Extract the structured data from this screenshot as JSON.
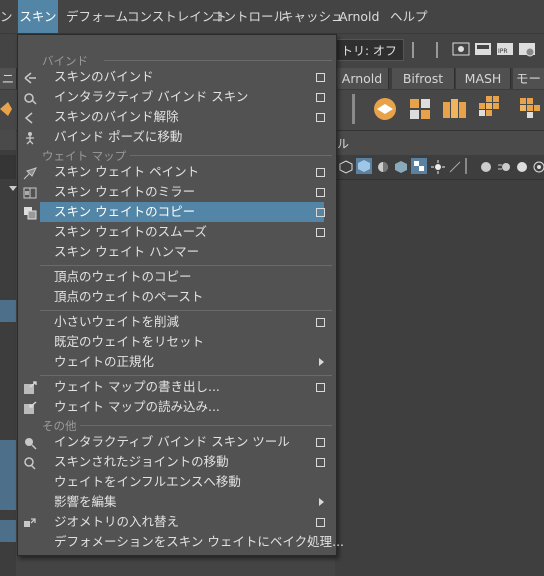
{
  "menubar": {
    "items": [
      {
        "label": "ン"
      },
      {
        "label": "スキン"
      },
      {
        "label": "デフォーム"
      },
      {
        "label": "コンストレイント"
      },
      {
        "label": "コントロール"
      },
      {
        "label": "キャッシュ"
      },
      {
        "label": "Arnold"
      },
      {
        "label": "ヘルプ"
      }
    ]
  },
  "statusline": {
    "field_label": "トリ: オフ"
  },
  "shelf_tabs": [
    "ニメ",
    "Arnold",
    "Bifrost",
    "MASH",
    "モー"
  ],
  "viewport_menu_label": "ル",
  "menu": {
    "sections": {
      "bind": "バインド",
      "weight_map": "ウェイト マップ",
      "other": "その他"
    },
    "items": {
      "bind_skin": "スキンのバインド",
      "interactive_bind_skin": "インタラクティブ バインド スキン",
      "unbind_skin": "スキンのバインド解除",
      "go_to_bind_pose": "バインド ポーズに移動",
      "paint_skin_weights": "スキン ウェイト ペイント",
      "mirror_skin_weights": "スキン ウェイトのミラー",
      "copy_skin_weights": "スキン ウェイトのコピー",
      "smooth_skin_weights": "スキン ウェイトのスムーズ",
      "skin_weight_hammer": "スキン ウェイト ハンマー",
      "copy_vertex_weights": "頂点のウェイトのコピー",
      "paste_vertex_weights": "頂点のウェイトのペースト",
      "prune_small_weights": "小さいウェイトを削減",
      "reset_weights_default": "既定のウェイトをリセット",
      "normalize_weights": "ウェイトの正規化",
      "export_weight_maps": "ウェイト マップの書き出し...",
      "import_weight_maps": "ウェイト マップの読み込み...",
      "interactive_bind_skin_tool": "インタラクティブ バインド スキン ツール",
      "move_skinned_joints": "スキンされたジョイントの移動",
      "move_weights_to_influences": "ウェイトをインフルエンスへ移動",
      "edit_influences": "影響を編集",
      "substitute_geometry": "ジオメトリの入れ替え",
      "bake_deformation": "デフォメーションをスキン ウェイトにベイク処理..."
    }
  },
  "colors": {
    "highlight": "#5285a6",
    "menu_bg": "#525252",
    "app_bg": "#444444"
  }
}
